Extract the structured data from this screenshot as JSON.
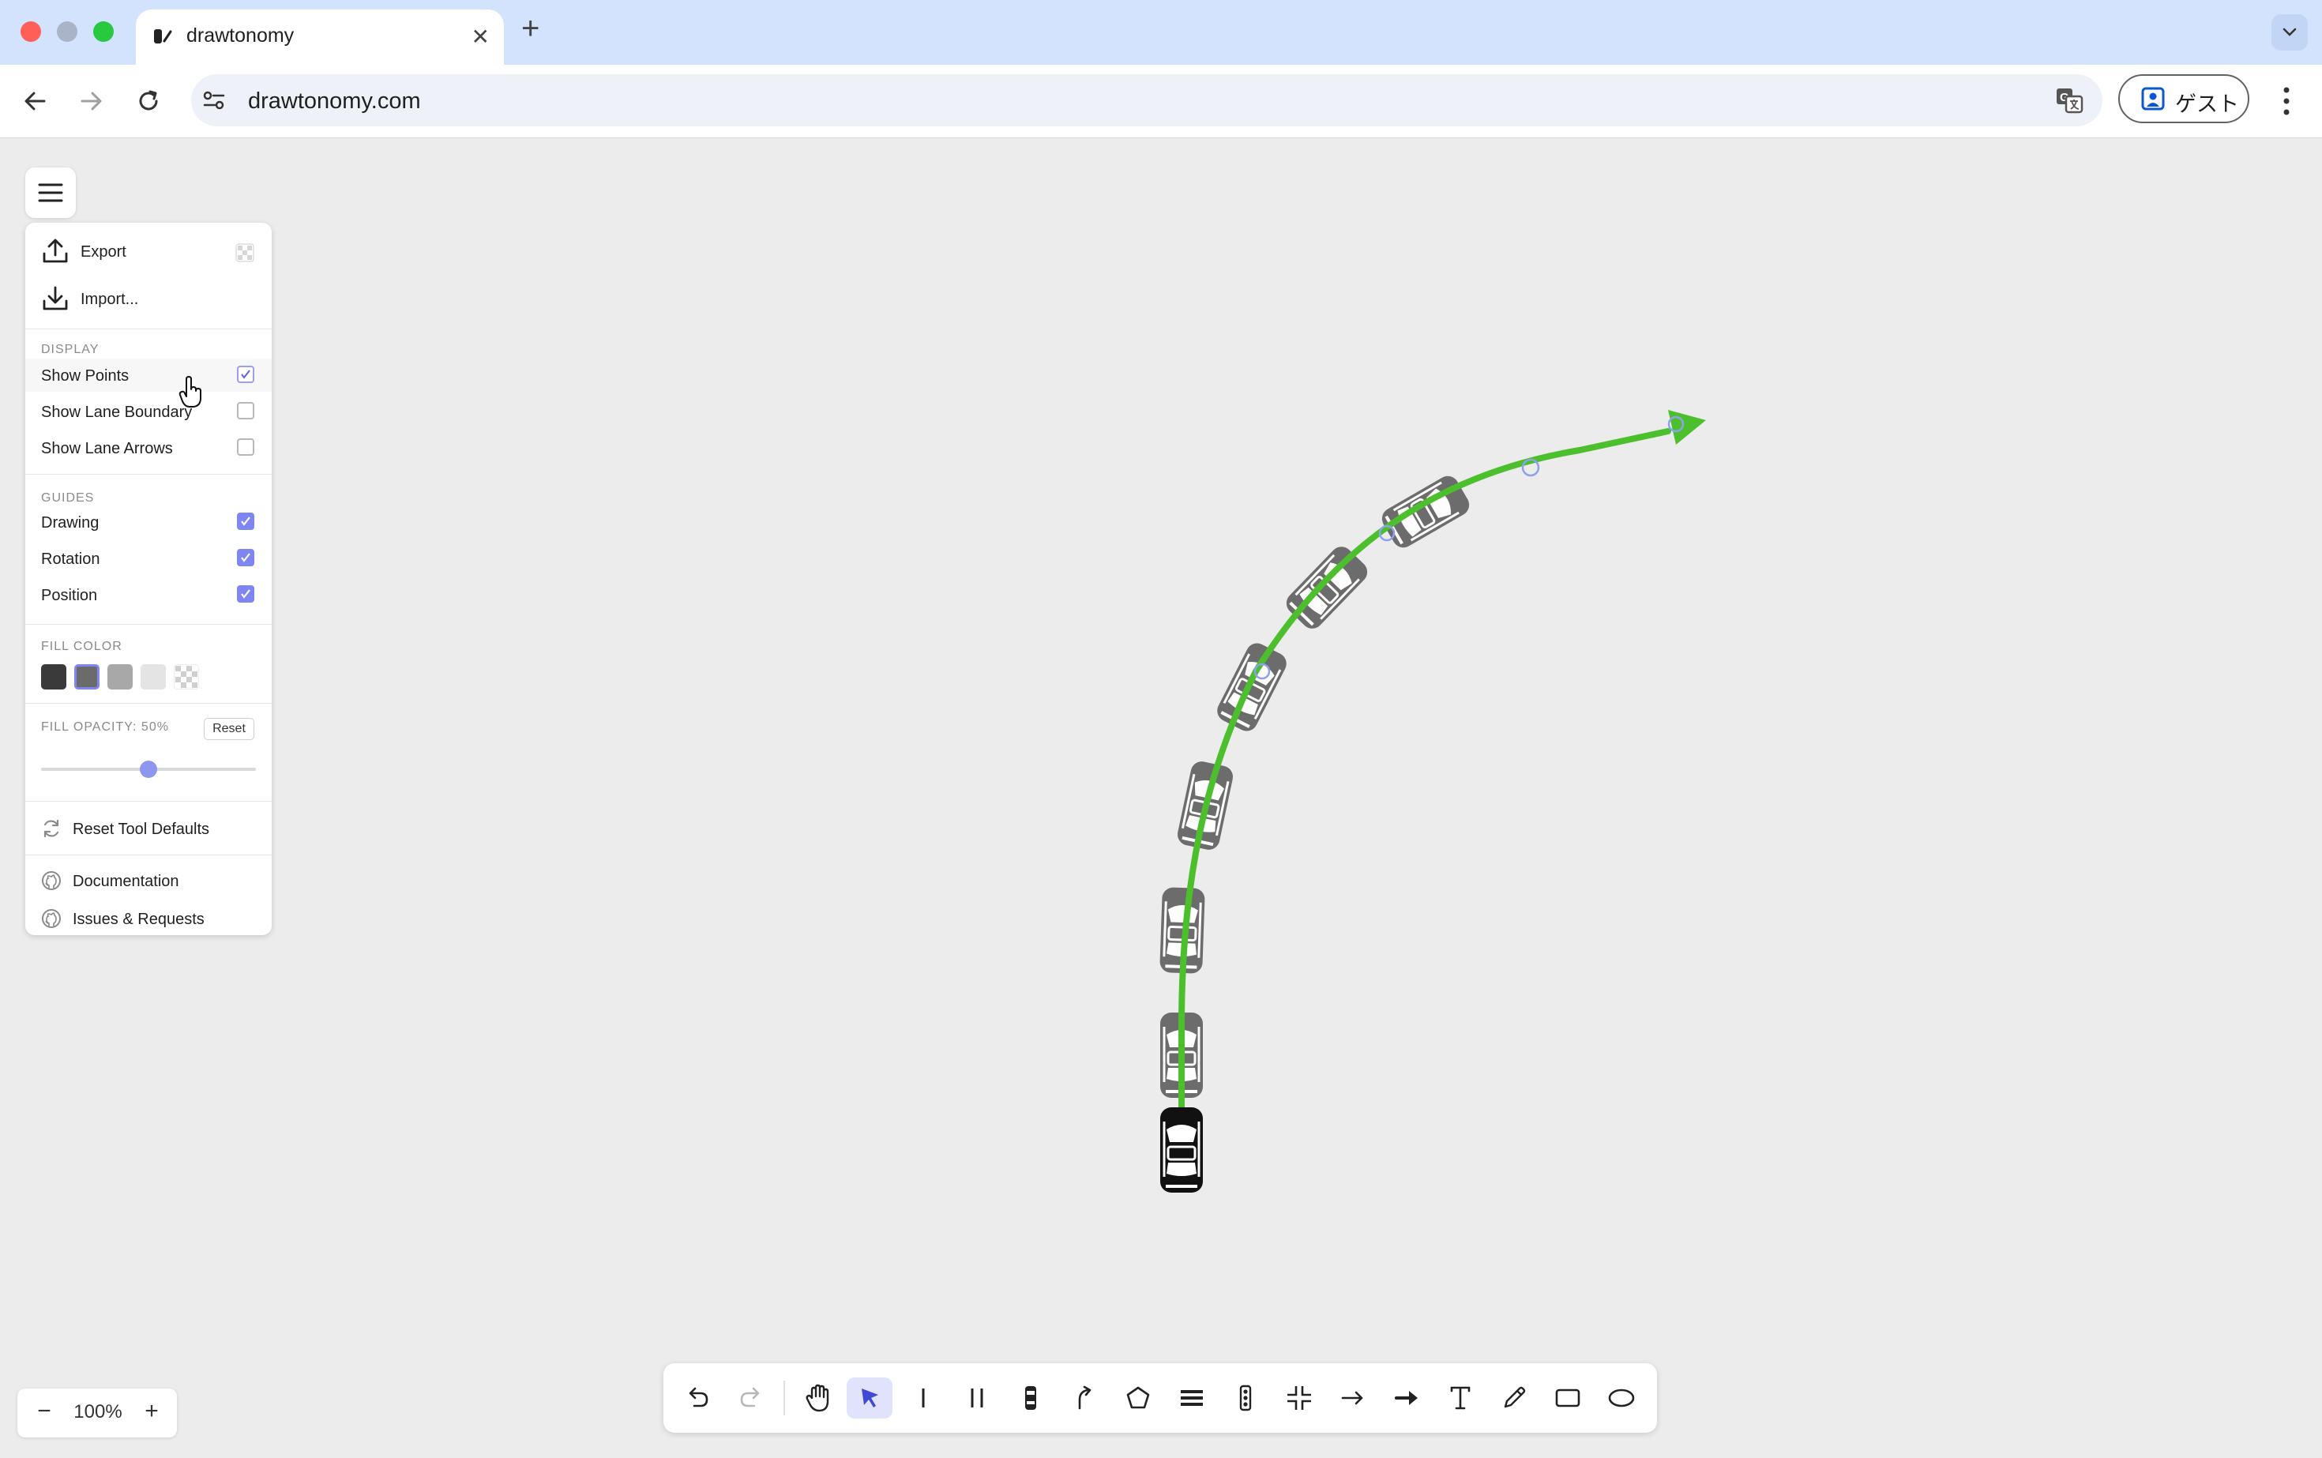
{
  "browser": {
    "tab_title": "drawtonomy",
    "url": "drawtonomy.com",
    "guest_label": "ゲスト",
    "traffic_lights": [
      "#ff5f57",
      "#a9b4c8",
      "#28c840"
    ]
  },
  "menu": {
    "export_label": "Export",
    "import_label": "Import...",
    "display_header": "DISPLAY",
    "display_items": [
      {
        "label": "Show Points",
        "checked": true
      },
      {
        "label": "Show Lane Boundary",
        "checked": false
      },
      {
        "label": "Show Lane Arrows",
        "checked": false
      }
    ],
    "guides_header": "GUIDES",
    "guides_items": [
      {
        "label": "Drawing",
        "checked": true
      },
      {
        "label": "Rotation",
        "checked": true
      },
      {
        "label": "Position",
        "checked": true
      }
    ],
    "fill_color_header": "FILL COLOR",
    "fill_colors": [
      "#3a3a3a",
      "#6b6b6b",
      "#a8a8a8",
      "#e4e4e4",
      "transparent"
    ],
    "selected_fill_color": "#6b6b6b",
    "fill_opacity_label": "FILL OPACITY: 50%",
    "fill_opacity": 0.5,
    "reset_label": "Reset",
    "reset_tool_defaults_label": "Reset Tool Defaults",
    "documentation_label": "Documentation",
    "issues_label": "Issues & Requests"
  },
  "zoom": {
    "minus": "−",
    "level": "100%",
    "plus": "+"
  },
  "tools": [
    {
      "name": "undo-icon",
      "active": false
    },
    {
      "name": "redo-icon",
      "active": false
    },
    {
      "name": "hand-icon",
      "active": false
    },
    {
      "name": "select-icon",
      "active": true
    },
    {
      "name": "lane-line-icon",
      "active": false
    },
    {
      "name": "lane-double-icon",
      "active": false
    },
    {
      "name": "vehicle-icon",
      "active": false
    },
    {
      "name": "path-icon",
      "active": false
    },
    {
      "name": "polygon-icon",
      "active": false
    },
    {
      "name": "crosswalk-icon",
      "active": false
    },
    {
      "name": "traffic-light-icon",
      "active": false
    },
    {
      "name": "intersection-icon",
      "active": false
    },
    {
      "name": "arrow-icon",
      "active": false
    },
    {
      "name": "bold-arrow-icon",
      "active": false
    },
    {
      "name": "text-icon",
      "active": false
    },
    {
      "name": "pencil-icon",
      "active": false
    },
    {
      "name": "rectangle-icon",
      "active": false
    },
    {
      "name": "ellipse-icon",
      "active": false
    }
  ],
  "colors": {
    "path": "#4cbf2c",
    "vehicle_ghost": "#5a5a5a",
    "vehicle_main": "#111111",
    "accent": "#7f86f2"
  }
}
